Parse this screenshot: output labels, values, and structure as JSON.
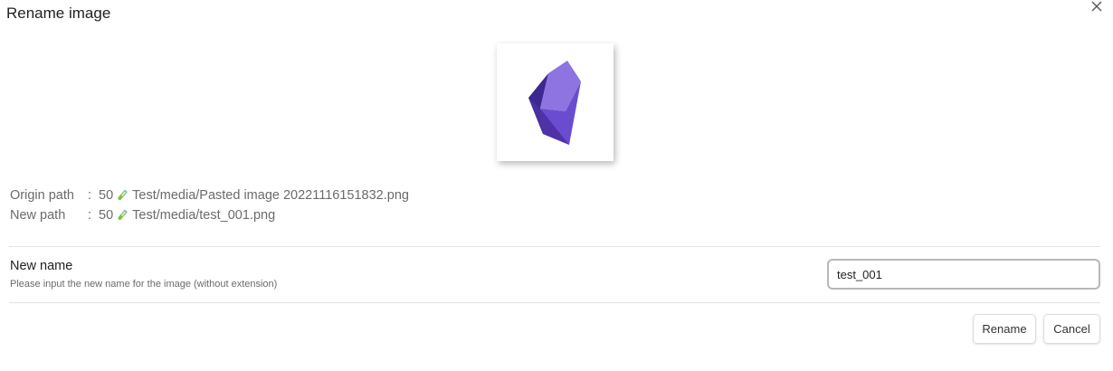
{
  "dialog": {
    "title": "Rename image",
    "close_icon": "close-icon"
  },
  "preview": {
    "icon": "obsidian-crystal-logo",
    "colors": [
      "#4f31a8",
      "#6a4cd0",
      "#8d74e0",
      "#3d2790"
    ]
  },
  "paths": {
    "origin": {
      "label": "Origin path",
      "separator": ":",
      "number": "50",
      "icon": "test-tube-icon",
      "value": "Test/media/Pasted image 20221116151832.png"
    },
    "new": {
      "label": "New path",
      "separator": ":",
      "number": "50",
      "icon": "test-tube-icon",
      "value": "Test/media/test_001.png"
    }
  },
  "setting": {
    "name": "New name",
    "description": "Please input the new name for the image (without extension)",
    "input_value": "test_001"
  },
  "buttons": {
    "rename": "Rename",
    "cancel": "Cancel"
  }
}
